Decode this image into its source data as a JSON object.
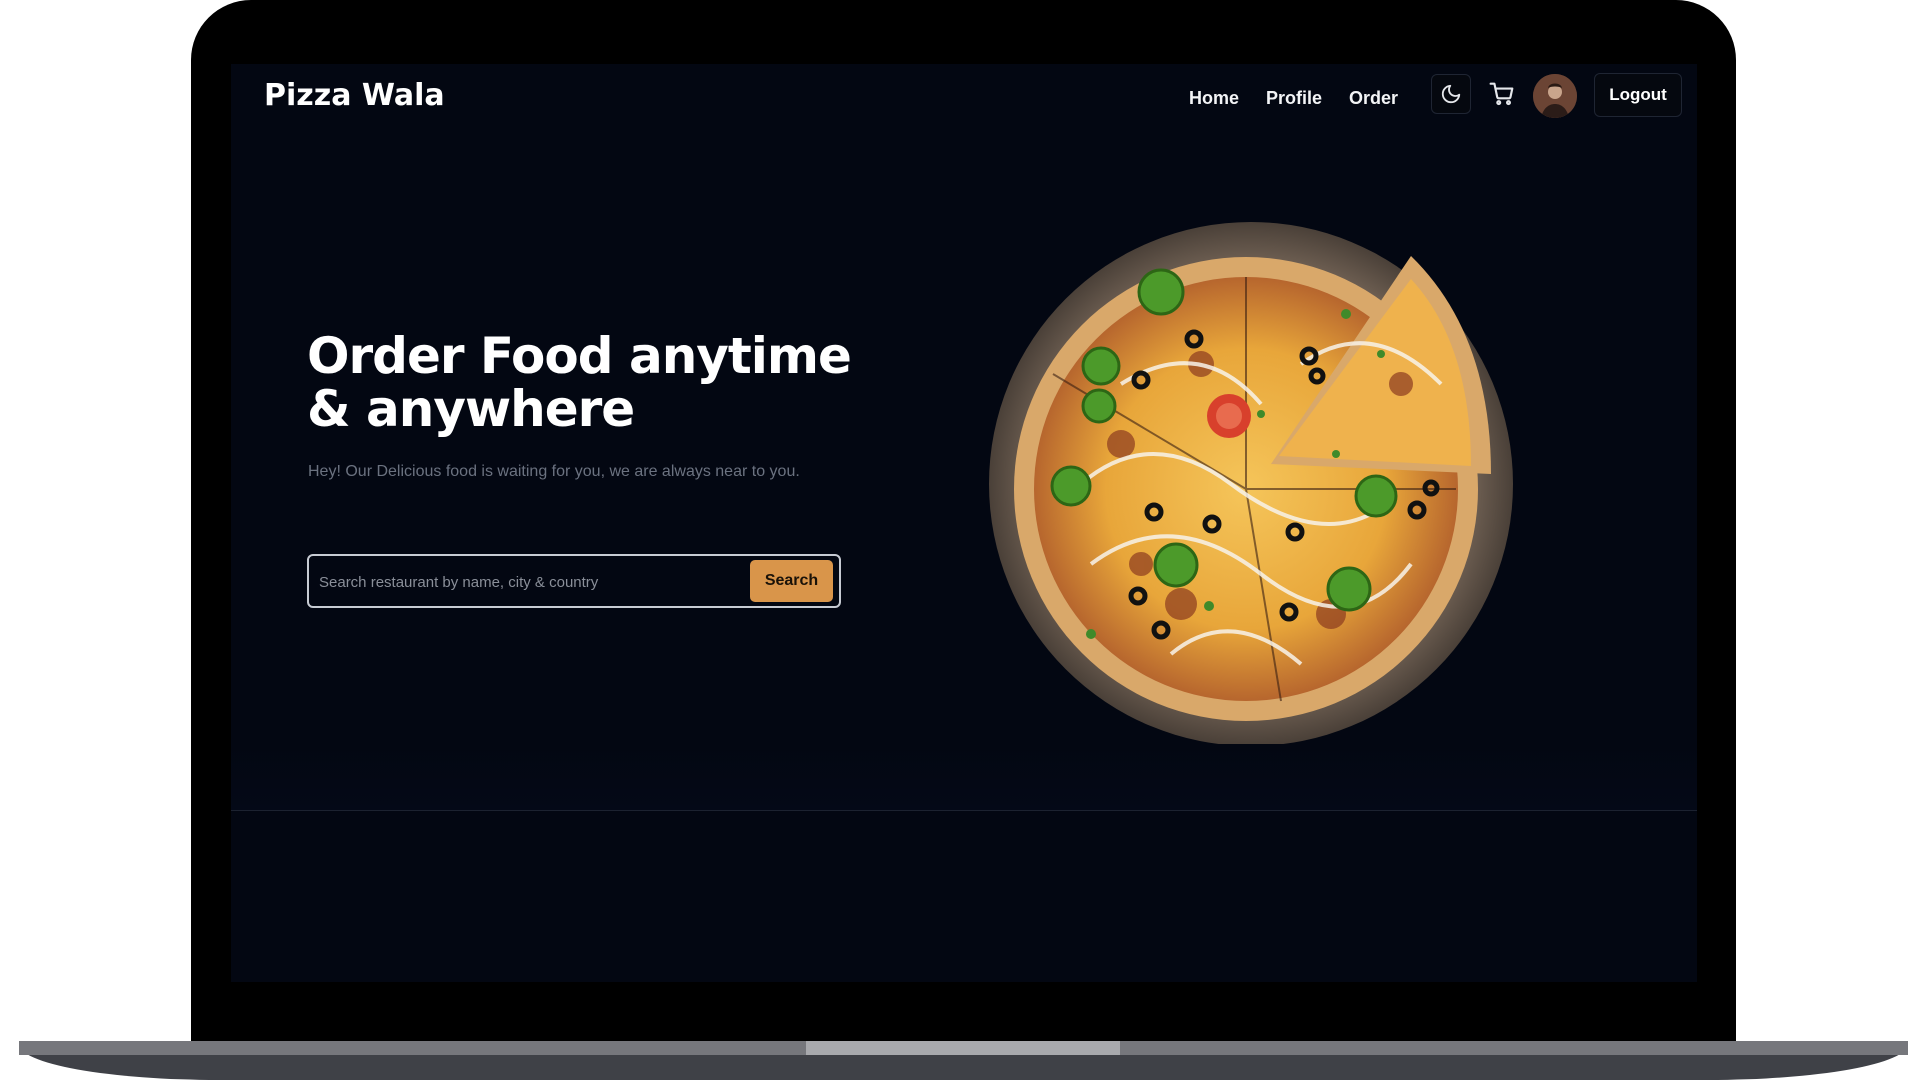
{
  "navbar": {
    "brand": "Pizza Wala",
    "links": [
      "Home",
      "Profile",
      "Order"
    ],
    "theme_icon": "moon-icon",
    "cart_icon": "cart-icon",
    "logout_label": "Logout"
  },
  "hero": {
    "title_line1": "Order Food anytime",
    "title_line2": "& anywhere",
    "subtitle": "Hey! Our Delicious food is waiting for you, we are always near to you.",
    "search": {
      "placeholder": "Search restaurant by name, city & country",
      "value": "",
      "button_label": "Search"
    },
    "image": "pizza-image"
  },
  "colors": {
    "background": "#030712",
    "accent": "#d9954a",
    "text": "#ffffff",
    "muted": "#6b7280"
  }
}
